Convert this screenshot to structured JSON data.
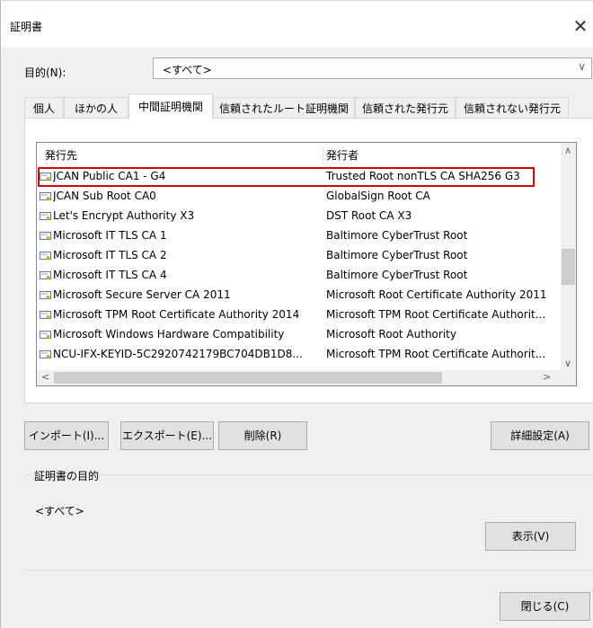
{
  "window": {
    "title": "証明書",
    "close_glyph": "✕"
  },
  "purpose": {
    "label": "目的(N):",
    "selected": "<すべて>"
  },
  "tabs": [
    {
      "label": "個人",
      "active": false
    },
    {
      "label": "ほかの人",
      "active": false
    },
    {
      "label": "中間証明機関",
      "active": true
    },
    {
      "label": "信頼されたルート証明機関",
      "active": false
    },
    {
      "label": "信頼された発行元",
      "active": false
    },
    {
      "label": "信頼されない発行元",
      "active": false
    }
  ],
  "columns": {
    "issued_to": "発行先",
    "issued_by": "発行者"
  },
  "rows": [
    {
      "to": "JCAN Public CA1 - G4",
      "by": "Trusted Root nonTLS CA SHA256 G3",
      "highlighted": true
    },
    {
      "to": "JCAN Sub Root CA0",
      "by": "GlobalSign Root CA"
    },
    {
      "to": "Let's Encrypt Authority X3",
      "by": "DST Root CA X3"
    },
    {
      "to": "Microsoft IT TLS CA 1",
      "by": "Baltimore CyberTrust Root"
    },
    {
      "to": "Microsoft IT TLS CA 2",
      "by": "Baltimore CyberTrust Root"
    },
    {
      "to": "Microsoft IT TLS CA 4",
      "by": "Baltimore CyberTrust Root"
    },
    {
      "to": "Microsoft Secure Server CA 2011",
      "by": "Microsoft Root Certificate Authority 2011"
    },
    {
      "to": "Microsoft TPM Root Certificate Authority 2014",
      "by": "Microsoft TPM Root Certificate Authorit..."
    },
    {
      "to": "Microsoft Windows Hardware Compatibility",
      "by": "Microsoft Root Authority"
    },
    {
      "to": "NCU-IFX-KEYID-5C2920742179BC704DB1D8...",
      "by": "Microsoft TPM Root Certificate Authorit..."
    }
  ],
  "buttons": {
    "import": "インポート(I)...",
    "export": "エクスポート(E)...",
    "delete": "削除(R)",
    "advanced": "詳細設定(A)",
    "view": "表示(V)",
    "close": "閉じる(C)"
  },
  "cert_purpose": {
    "title": "証明書の目的",
    "value": "<すべて>"
  },
  "colors": {
    "highlight": "#d40000",
    "accent_bg": "#f0f0f0"
  }
}
